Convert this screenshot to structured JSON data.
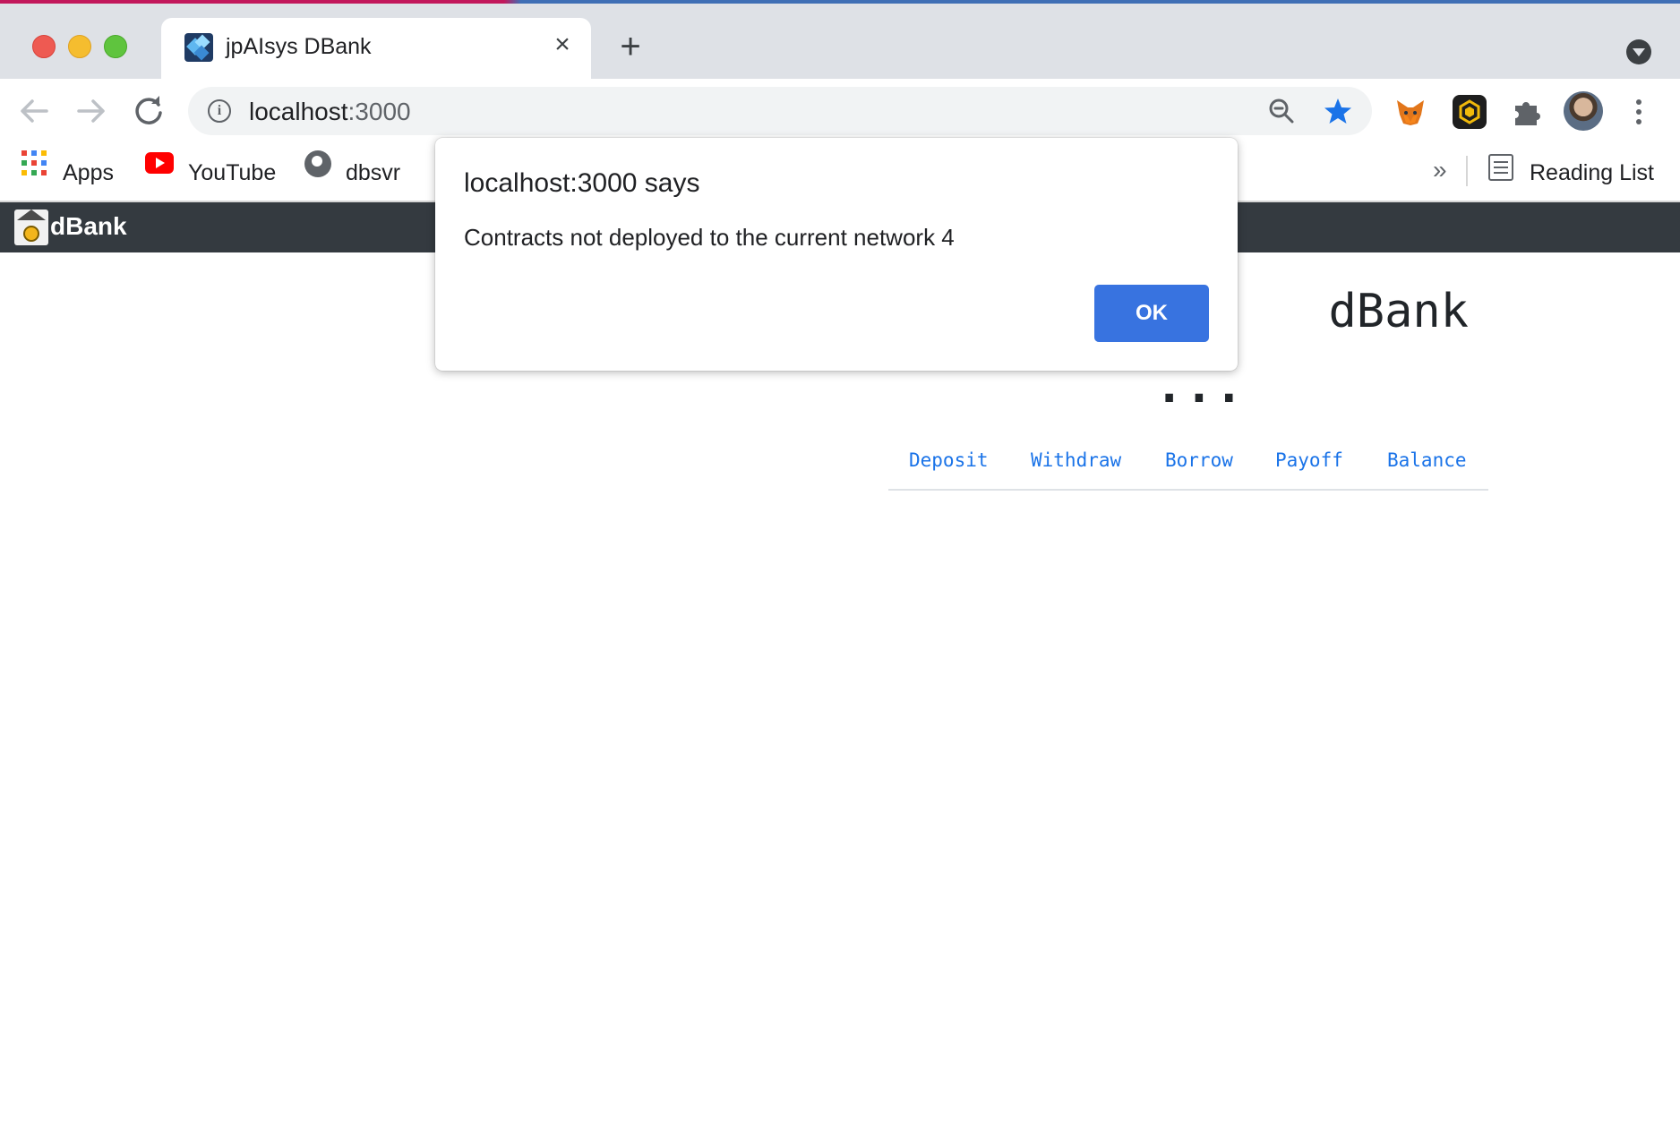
{
  "browser": {
    "tab_title": "jpAIsys DBank",
    "tab_close_icon": "close-icon",
    "new_tab_symbol": "+",
    "url_host": "localhost",
    "url_port": ":3000",
    "bookmarks": [
      {
        "label": "Apps",
        "icon": "apps-grid-icon"
      },
      {
        "label": "YouTube",
        "icon": "youtube-icon"
      },
      {
        "label": "dbsvr",
        "icon": "globe-icon"
      }
    ],
    "overflow_symbol": "»",
    "reading_list_label": "Reading List",
    "colors": {
      "tabstrip": "#dee1e6",
      "star": "#1a73e8"
    }
  },
  "app": {
    "brand_name": "dBank",
    "heading_visible": "dBank",
    "loading_text": "...",
    "tabs": [
      "Deposit",
      "Withdraw",
      "Borrow",
      "Payoff",
      "Balance"
    ],
    "navbar_color": "#343a40",
    "link_color": "#1a73e8"
  },
  "dialog": {
    "title": "localhost:3000 says",
    "message": "Contracts not deployed to the current network 4",
    "ok_label": "OK",
    "button_color": "#3873e0"
  }
}
